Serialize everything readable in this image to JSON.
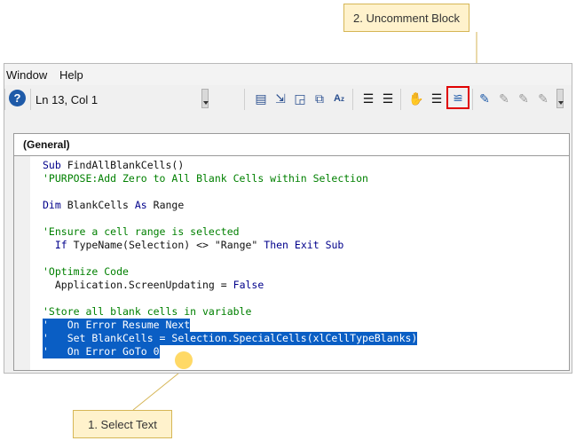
{
  "callouts": {
    "uncomment": "2. Uncomment Block",
    "select": "1. Select Text"
  },
  "menu": {
    "window": "Window",
    "help": "Help"
  },
  "toolbar": {
    "status": "Ln 13, Col 1"
  },
  "code_window": {
    "procedure": "(General)"
  },
  "code": {
    "l1": {
      "a": "Sub",
      "b": " FindAllBlankCells()"
    },
    "l2": "'PURPOSE:Add Zero to All Blank Cells within Selection",
    "l4": {
      "a": "Dim",
      "b": " BlankCells ",
      "c": "As",
      "d": " Range"
    },
    "l6": "'Ensure a cell range is selected",
    "l7": {
      "a": "  ",
      "b": "If",
      "c": " TypeName(Selection) <> \"Range\" ",
      "d": "Then",
      "e": " ",
      "f": "Exit",
      "g": " ",
      "h": "Sub"
    },
    "l9": "'Optimize Code",
    "l10": {
      "a": "  Application.ScreenUpdating = ",
      "b": "False"
    },
    "l12": "'Store all blank cells in variable",
    "l13": "'   On Error Resume Next",
    "l14": "'   Set BlankCells = Selection.SpecialCells(xlCellTypeBlanks)",
    "l15": "'   On Error GoTo 0"
  },
  "colors": {
    "selection": "#0a5ec4",
    "keyword": "#00008b",
    "comment": "#008000",
    "callout_bg": "#fff2cc",
    "highlight_box": "#e00000"
  }
}
